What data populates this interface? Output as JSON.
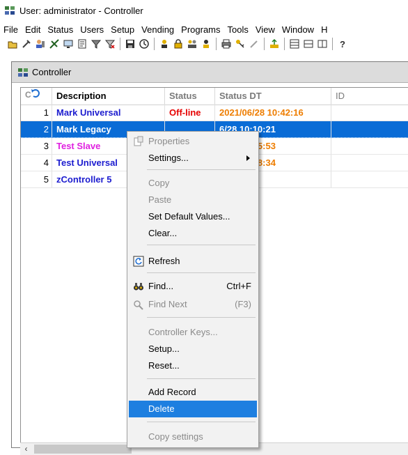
{
  "window": {
    "title": "User: administrator - Controller"
  },
  "menu": [
    "File",
    "Edit",
    "Status",
    "Users",
    "Setup",
    "Vending",
    "Programs",
    "Tools",
    "View",
    "Window",
    "H"
  ],
  "child": {
    "title": "Controller"
  },
  "grid": {
    "columns": [
      "Description",
      "Status",
      "Status DT",
      "ID"
    ],
    "rows": [
      {
        "num": "1",
        "desc": "Mark Universal",
        "status": "Off-line",
        "dt": "2021/06/28 10:42:16",
        "desc_color": "#1c1ccf",
        "status_color": "#e60000",
        "dt_color": "#ee7d00"
      },
      {
        "num": "2",
        "desc": "Mark Legacy",
        "status": "",
        "dt": "6/28 10:10:21",
        "desc_color": "#ffffff",
        "status_color": "#ffffff",
        "dt_color": "#ffffff"
      },
      {
        "num": "3",
        "desc": "Test Slave",
        "status": "",
        "dt": "6/27 14:25:53",
        "desc_color": "#e020e0",
        "status_color": "#000000",
        "dt_color": "#ee7d00"
      },
      {
        "num": "4",
        "desc": "Test Universal",
        "status": "",
        "dt": "6/28 10:28:34",
        "desc_color": "#1c1ccf",
        "status_color": "#000000",
        "dt_color": "#ee7d00"
      },
      {
        "num": "5",
        "desc": "zController 5",
        "status": "",
        "dt": "",
        "desc_color": "#1c1ccf",
        "status_color": "#000000",
        "dt_color": "#ee7d00"
      }
    ]
  },
  "context_menu": {
    "properties": "Properties",
    "settings": "Settings...",
    "copy": "Copy",
    "paste": "Paste",
    "set_default": "Set Default Values...",
    "clear": "Clear...",
    "refresh": "Refresh",
    "find": "Find...",
    "find_shortcut": "Ctrl+F",
    "find_next": "Find Next",
    "find_next_shortcut": "(F3)",
    "controller_keys": "Controller Keys...",
    "setup": "Setup...",
    "reset": "Reset...",
    "add_record": "Add Record",
    "delete": "Delete",
    "copy_settings": "Copy settings"
  },
  "colors": {
    "selection": "#0a6cd6",
    "menu_highlight": "#1e7fe0"
  }
}
